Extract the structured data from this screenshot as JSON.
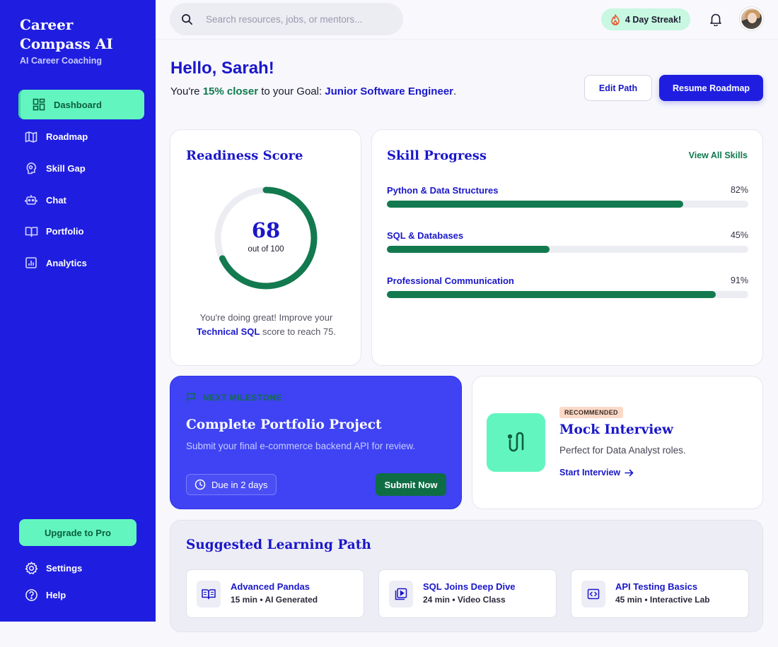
{
  "brand": {
    "title": "Career Compass AI",
    "subtitle": "AI Career Coaching"
  },
  "nav": [
    {
      "label": "Dashboard",
      "icon": "dashboard-icon",
      "active": true
    },
    {
      "label": "Roadmap",
      "icon": "map-icon"
    },
    {
      "label": "Skill Gap",
      "icon": "brain-icon"
    },
    {
      "label": "Chat",
      "icon": "robot-icon"
    },
    {
      "label": "Portfolio",
      "icon": "book-icon"
    },
    {
      "label": "Analytics",
      "icon": "analytics-icon"
    }
  ],
  "sidebar_footer": {
    "upgrade_label": "Upgrade to Pro",
    "settings_label": "Settings",
    "help_label": "Help"
  },
  "search": {
    "placeholder": "Search resources, jobs, or mentors..."
  },
  "streak": {
    "label": "4 Day Streak!"
  },
  "header": {
    "greeting": "Hello, Sarah!",
    "goal_prefix": "You're ",
    "goal_pct": "15% closer",
    "goal_mid": " to your Goal: ",
    "goal_name": "Junior Software Engineer",
    "goal_suffix": ".",
    "edit_label": "Edit Path",
    "resume_label": "Resume Roadmap"
  },
  "readiness": {
    "title": "Readiness Score",
    "score": "68",
    "score_value": 68,
    "out_of": "out of 100",
    "note_pre": "You're doing great! Improve your ",
    "note_hl": "Technical SQL",
    "note_post": " score to reach 75."
  },
  "skills": {
    "title": "Skill Progress",
    "view_all": "View All Skills",
    "items": [
      {
        "label": "Python & Data Structures",
        "pct": "82%",
        "value": 82
      },
      {
        "label": "SQL & Databases",
        "pct": "45%",
        "value": 45
      },
      {
        "label": "Professional Communication",
        "pct": "91%",
        "value": 91
      }
    ]
  },
  "milestone": {
    "tag": "NEXT MILESTONE",
    "title": "Complete Portfolio Project",
    "desc": "Submit your final e-commerce backend API for review.",
    "due": "Due in 2 days",
    "submit_label": "Submit Now"
  },
  "mock": {
    "badge": "RECOMMENDED",
    "title": "Mock Interview",
    "desc": "Perfect for Data Analyst roles.",
    "link": "Start Interview"
  },
  "learning": {
    "title": "Suggested Learning Path",
    "items": [
      {
        "title": "Advanced Pandas",
        "meta": "15 min • AI Generated",
        "icon": "book-open-icon"
      },
      {
        "title": "SQL Joins Deep Dive",
        "meta": "24 min • Video Class",
        "icon": "video-icon"
      },
      {
        "title": "API Testing Basics",
        "meta": "45 min • Interactive Lab",
        "icon": "code-icon"
      }
    ]
  },
  "colors": {
    "primary": "#1f1ee0",
    "accent": "#63f5c0",
    "success": "#137a4f"
  }
}
